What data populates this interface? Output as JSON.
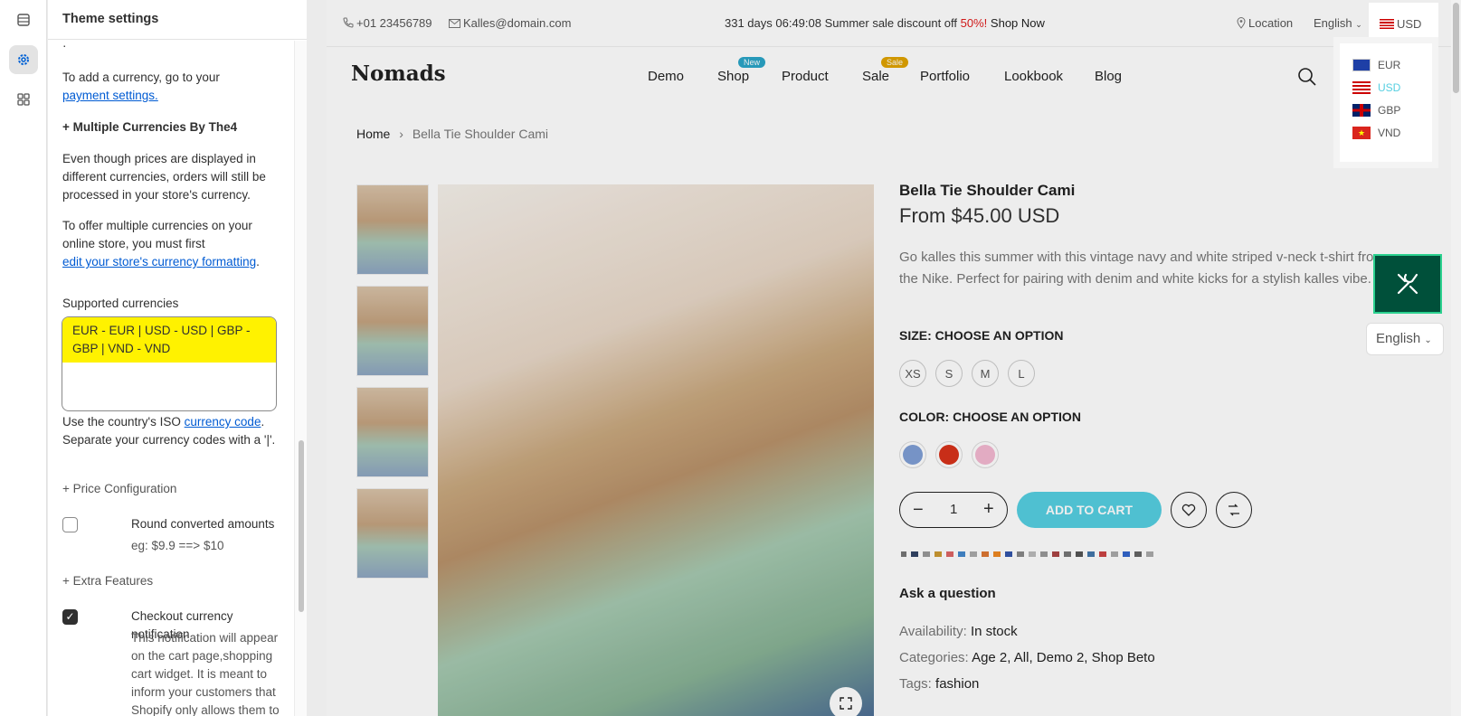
{
  "panel": {
    "title": "Theme settings",
    "dot": "·",
    "add_currency_text": "To add a currency, go to your",
    "payment_link": "payment settings.",
    "multi_heading": "+ Multiple Currencies By The4",
    "even_though": "Even though prices are displayed in different currencies, orders will still be processed in your store's currency.",
    "to_offer": "To offer multiple currencies on your online store, you must first",
    "formatting_link": "edit your store's currency formatting",
    "formatting_period": ".",
    "supported_label": "Supported currencies",
    "supported_value": "EUR - EUR | USD - USD | GBP - GBP | VND - VND",
    "help_pre": "Use the country's ISO",
    "help_link": "currency code",
    "help_post": ". Separate your currency codes with a '|'.",
    "price_config": "+ Price Configuration",
    "round_label": "Round converted amounts",
    "round_example": "eg: $9.9 ==> $10",
    "extra_features": "+ Extra Features",
    "notify_label": "Checkout currency notification",
    "notify_desc": "This notification will appear on the cart page,shopping cart widget. It is meant to inform your customers that Shopify only allows them to Checkout in your"
  },
  "topbar": {
    "phone": "+01 23456789",
    "email": "Kalles@domain.com",
    "promo_prefix": "331 days 06:49:08 Summer sale discount off ",
    "promo_pct": "50%!",
    "promo_link": "Shop Now",
    "location": "Location",
    "language": "English",
    "currency": "USD"
  },
  "currency_options": [
    "EUR",
    "USD",
    "GBP",
    "VND"
  ],
  "logo": "Nomads",
  "nav": {
    "demo": "Demo",
    "shop": "Shop",
    "shop_badge": "New",
    "product": "Product",
    "sale": "Sale",
    "sale_badge": "Sale",
    "portfolio": "Portfolio",
    "lookbook": "Lookbook",
    "blog": "Blog"
  },
  "breadcrumb": {
    "home": "Home",
    "sep": "›",
    "current": "Bella Tie Shoulder Cami"
  },
  "product": {
    "title": "Bella Tie Shoulder Cami",
    "price": "From $45.00 USD",
    "description": "Go kalles this summer with this vintage navy and white striped v-neck t-shirt from the Nike. Perfect for pairing with denim and white kicks for a stylish kalles vibe.",
    "size_label": "SIZE: CHOOSE AN OPTION",
    "sizes": [
      "XS",
      "S",
      "M",
      "L"
    ],
    "color_label": "COLOR: CHOOSE AN OPTION",
    "colors": [
      "#7f9fd6",
      "#d8321a",
      "#f4b8d1"
    ],
    "qty": "1",
    "add_to_cart": "ADD TO CART",
    "ask": "Ask a question",
    "availability_label": "Availability:",
    "availability": "In stock",
    "categories_label": "Categories:",
    "categories": "Age 2, All, Demo 2, Shop Beto",
    "tags_label": "Tags:",
    "tags": "fashion"
  },
  "side_lang": "English",
  "colors": {
    "accent": "#56cfe1",
    "link": "#005bd3",
    "highlight": "#fff200",
    "sale_red": "#e01b1b",
    "tool_bg": "#00503a"
  }
}
